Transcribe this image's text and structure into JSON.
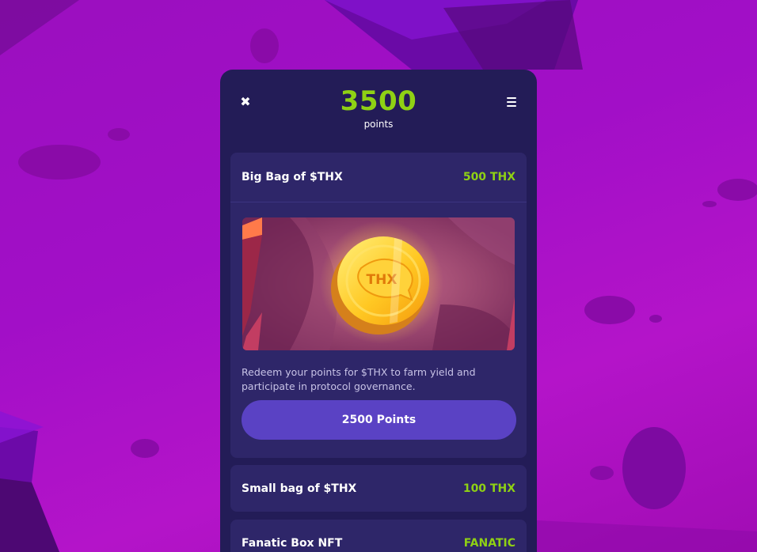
{
  "header": {
    "close_icon": "close-icon",
    "menu_icon": "menu-icon",
    "points_value": "3500",
    "points_label": "points"
  },
  "rewards": [
    {
      "title": "Big Bag of $THX",
      "reward": "500 THX",
      "expanded": true,
      "image_text": "THX",
      "description": "Redeem your points for $THX to farm yield and participate in protocol governance.",
      "button_label": "2500 Points"
    },
    {
      "title": "Small bag of $THX",
      "reward": "100 THX",
      "expanded": false
    },
    {
      "title": "Fanatic Box NFT",
      "reward": "FANATIC",
      "expanded": false
    }
  ],
  "colors": {
    "accent_green": "#8fd114",
    "panel": "#231c57",
    "card": "#2e2669",
    "button": "#5a42c4",
    "background": "#a20fc7"
  }
}
